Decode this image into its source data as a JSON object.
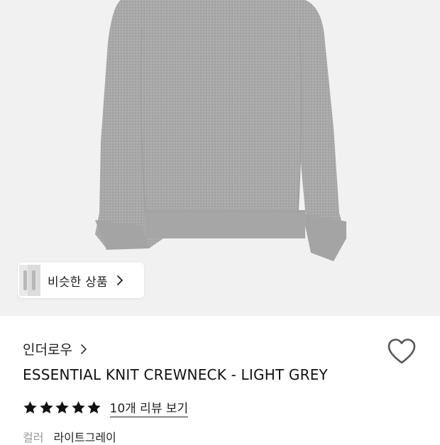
{
  "hero": {
    "similar_label": "비슷한 상품"
  },
  "product": {
    "brand": "인더로우",
    "title": "ESSENTIAL KNIT CREWNECK - LIGHT GREY",
    "rating_stars": 5,
    "review_link": "10개 리뷰 보기",
    "color_label": "컬러",
    "color_value": "라이트그레이"
  },
  "colors": {
    "hero_bg": "#f1f1f1",
    "sweater": "#a9a9a9",
    "text": "#1a1a1a",
    "muted": "#999999"
  }
}
